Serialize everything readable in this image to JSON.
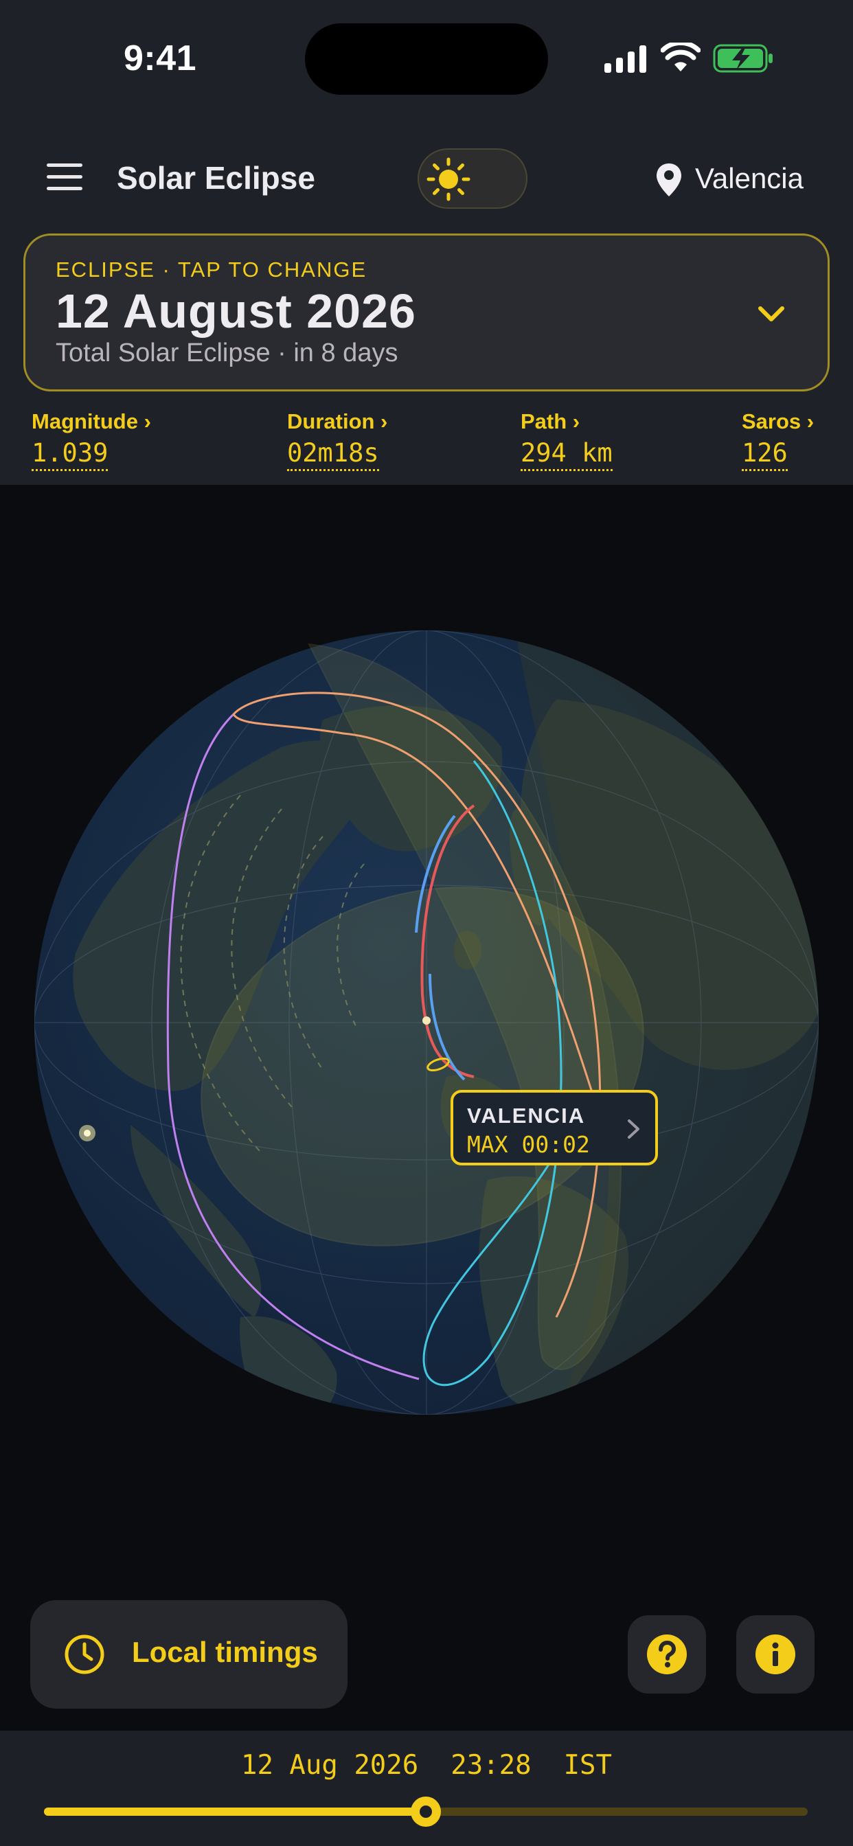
{
  "status_bar": {
    "time": "9:41"
  },
  "header": {
    "title": "Solar Eclipse",
    "location": "Valencia",
    "theme": "light"
  },
  "eclipse_card": {
    "kicker": "ECLIPSE · TAP TO CHANGE",
    "date": "12 August 2026",
    "subtitle": "Total Solar Eclipse · in 8 days"
  },
  "stats": [
    {
      "label": "Magnitude ›",
      "value": "1.039"
    },
    {
      "label": "Duration ›",
      "value": "02m18s"
    },
    {
      "label": "Path ›",
      "value": "294 km"
    },
    {
      "label": "Saros ›",
      "value": "126"
    }
  ],
  "map": {
    "callout_city": "VALENCIA",
    "callout_max": "MAX 00:02"
  },
  "bottom": {
    "timings_label": "Local timings",
    "help_icon": "question-icon",
    "info_icon": "info-icon"
  },
  "timeline": {
    "readout": "12 Aug 2026  23:28  IST",
    "progress": 0.5
  },
  "colors": {
    "accent": "#f3cd1a",
    "background": "#0b0c10",
    "panel": "#1f2128",
    "ocean": "#182c44",
    "land": "#2a3a3c",
    "path_center": "#e85a5a",
    "path_limit": "#5aa0f0",
    "outline_orange": "#f0a070",
    "outline_violet": "#c080f0",
    "outline_cyan": "#40c8e0"
  }
}
